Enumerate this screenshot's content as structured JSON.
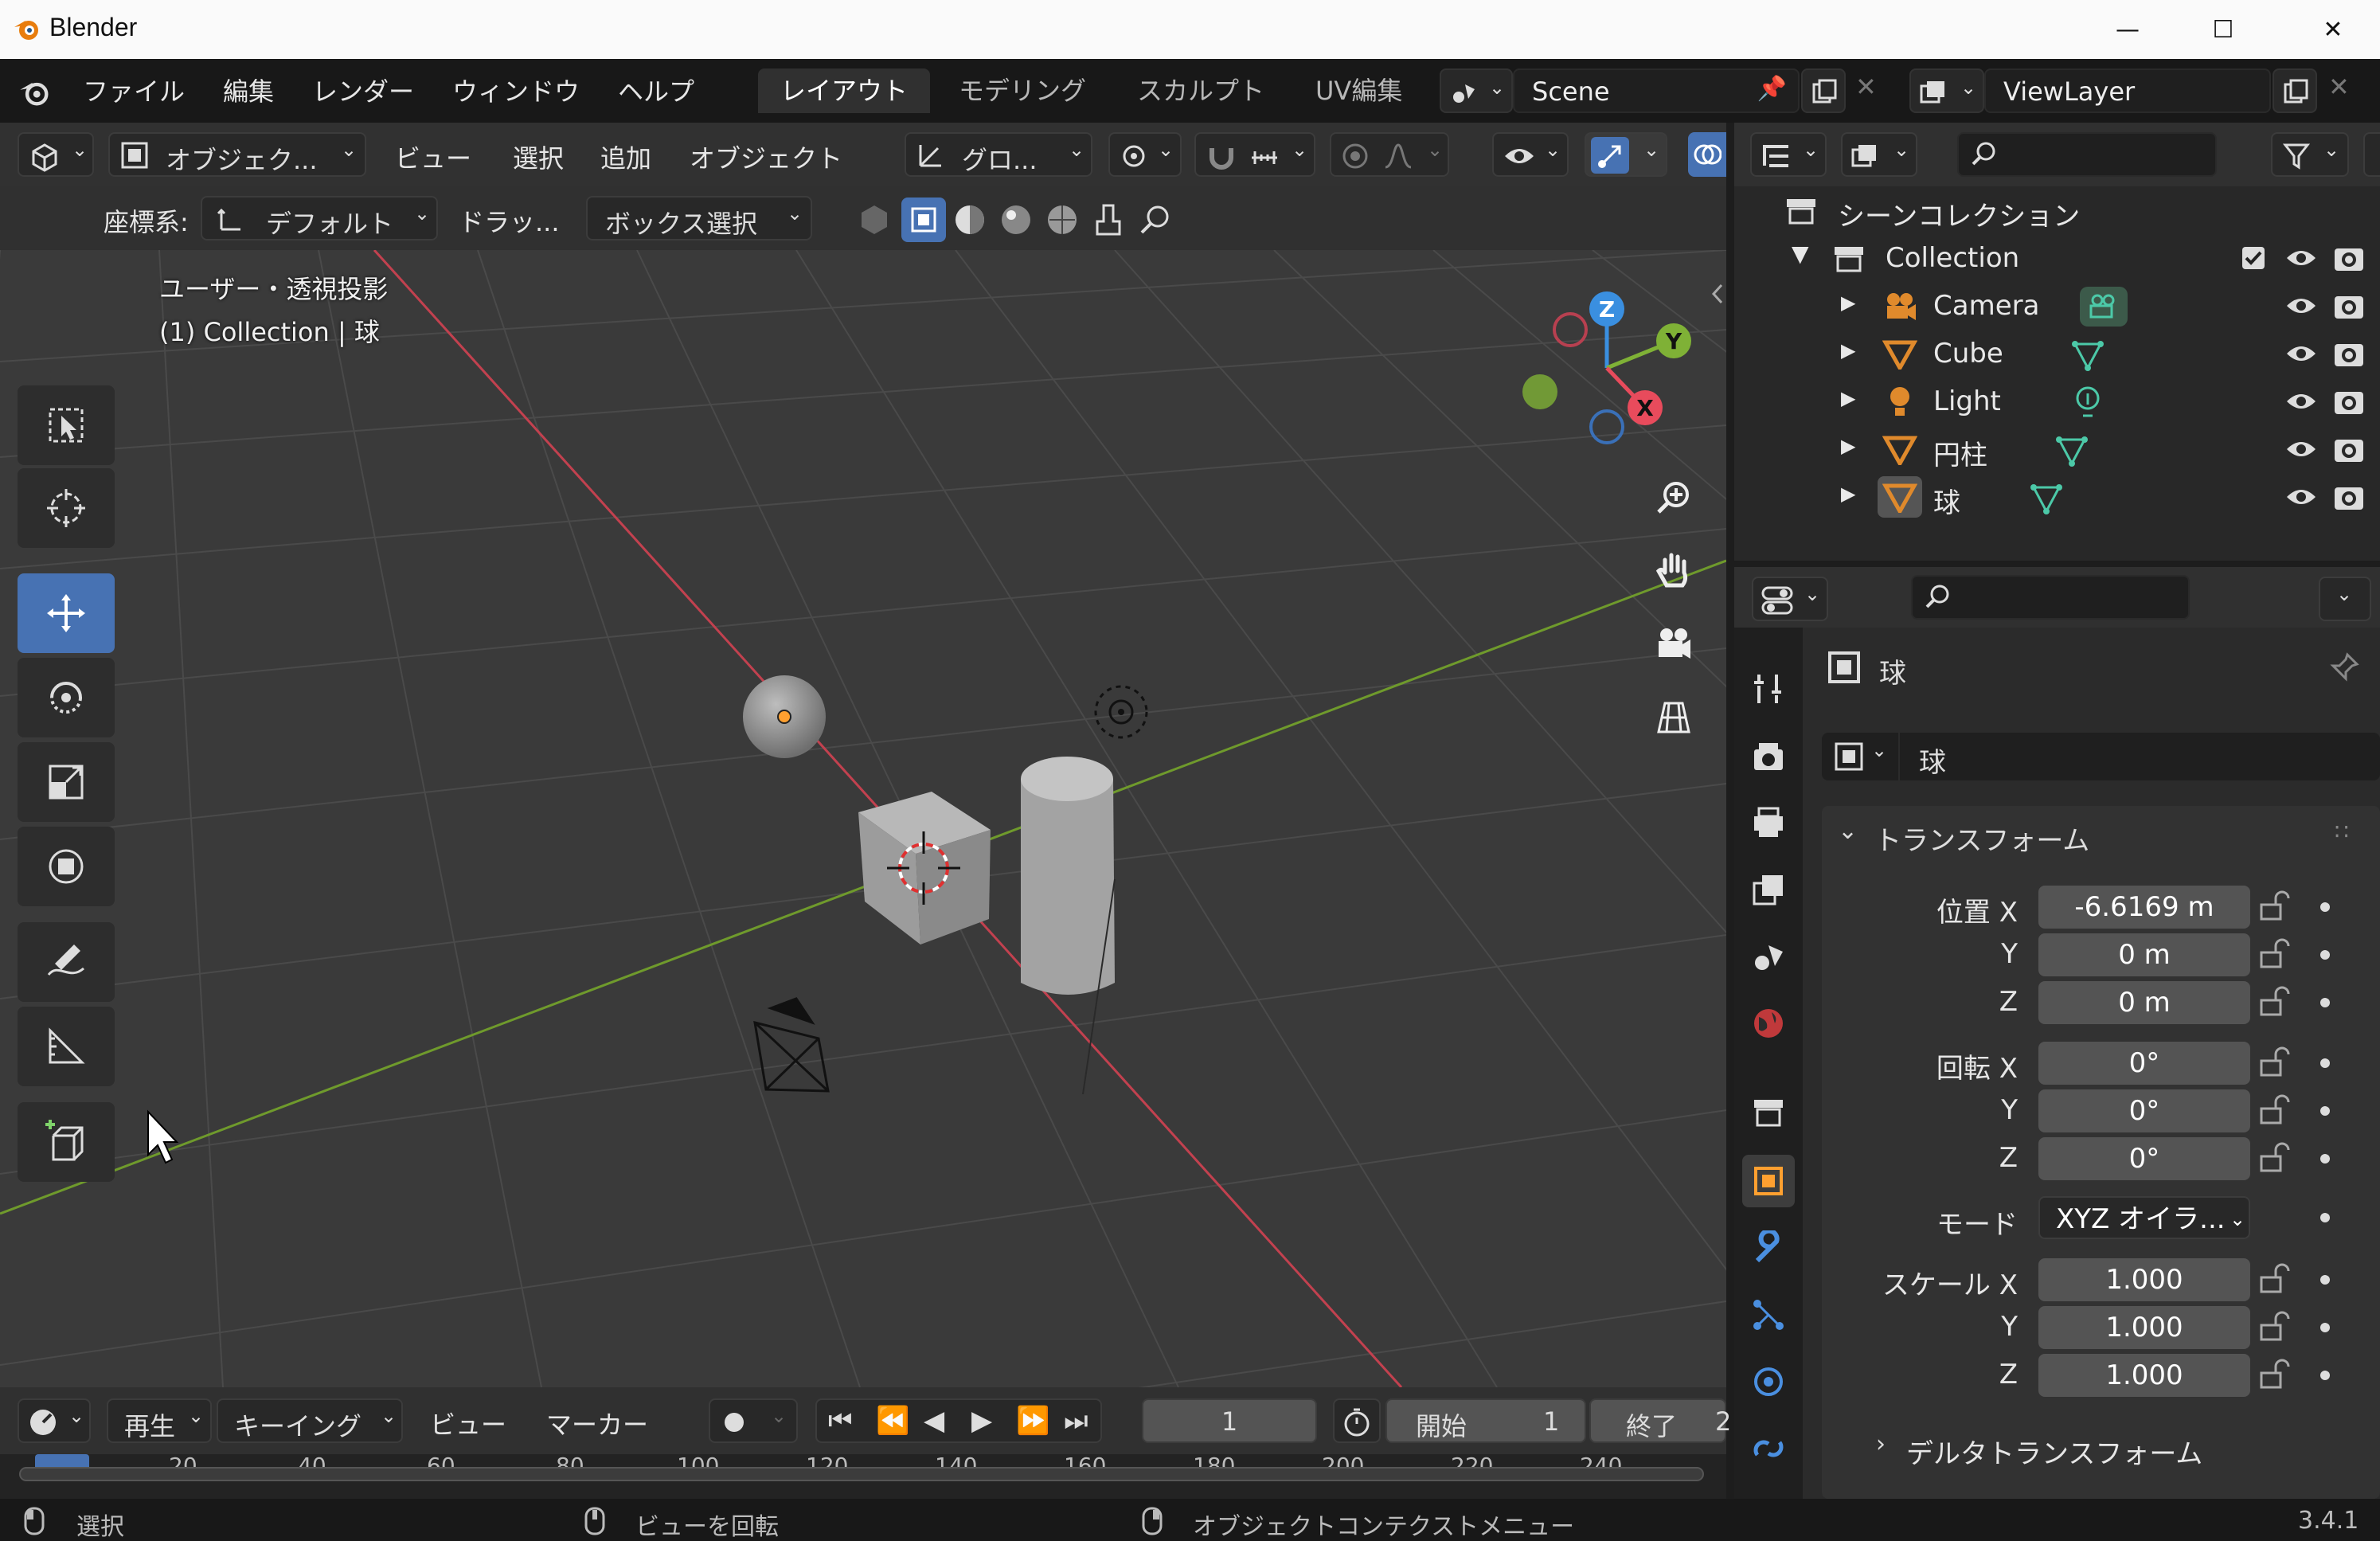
{
  "window": {
    "title": "Blender",
    "minimize": "—",
    "maximize": "☐",
    "close": "✕"
  },
  "menu": {
    "file": "ファイル",
    "edit": "編集",
    "render": "レンダー",
    "window": "ウィンドウ",
    "help": "ヘルプ"
  },
  "workspaces": [
    "レイアウト",
    "モデリング",
    "スカルプト",
    "UV編集"
  ],
  "scene": {
    "name": "Scene",
    "view_layer": "ViewLayer"
  },
  "viewport_header": {
    "mode": "オブジェク...",
    "view": "ビュー",
    "select": "選択",
    "add": "追加",
    "object": "オブジェクト",
    "transform_orientation": "グロ..."
  },
  "tool_settings": {
    "coord_label": "座標系:",
    "coord_value": "デフォルト",
    "drag_label": "ドラッ...",
    "drag_value": "ボックス選択"
  },
  "viewport": {
    "projection": "ユーザー・透視投影",
    "context": "(1) Collection | 球",
    "gizmo": {
      "x": "X",
      "y": "Y",
      "z": "Z"
    }
  },
  "timeline": {
    "playback": "再生",
    "keying": "キーイング",
    "view": "ビュー",
    "marker": "マーカー",
    "current_frame": "1",
    "start_label": "開始",
    "start_value": "1",
    "end_label": "終了",
    "end_value": "2",
    "ruler": [
      "20",
      "40",
      "60",
      "80",
      "100",
      "120",
      "140",
      "160",
      "180",
      "200",
      "220",
      "240"
    ]
  },
  "status": {
    "select": "選択",
    "rotate": "ビューを回転",
    "context_menu": "オブジェクトコンテクストメニュー",
    "version": "3.4.1"
  },
  "outliner": {
    "root": "シーンコレクション",
    "collection": "Collection",
    "items": [
      {
        "name": "Camera"
      },
      {
        "name": "Cube"
      },
      {
        "name": "Light"
      },
      {
        "name": "円柱"
      },
      {
        "name": "球"
      }
    ]
  },
  "properties": {
    "object_name": "球",
    "object_field": "球",
    "transform_title": "トランスフォーム",
    "location_label": "位置 X",
    "location": [
      "-6.6169 m",
      "0 m",
      "0 m"
    ],
    "rotation_label": "回転 X",
    "rotation": [
      "0°",
      "0°",
      "0°"
    ],
    "mode_label": "モード",
    "mode_value": "XYZ オイラ...",
    "scale_label": "スケール X",
    "scale": [
      "1.000",
      "1.000",
      "1.000"
    ],
    "axis_y": "Y",
    "axis_z": "Z",
    "delta_title": "デルタトランスフォーム"
  },
  "colors": {
    "accent": "#4772b3",
    "x_axis": "#e84b5c",
    "y_axis": "#7fb136",
    "z_axis": "#3a8fe0",
    "selected": "#ffa030"
  }
}
